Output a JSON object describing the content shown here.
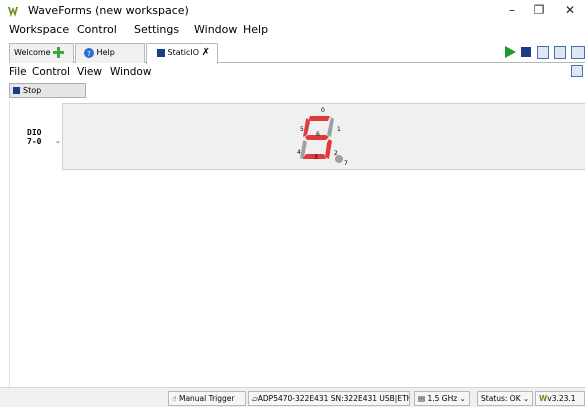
{
  "window": {
    "title": "WaveForms (new workspace)",
    "minimize": "–",
    "restore": "❐",
    "close": "✕"
  },
  "main_menu": [
    "Workspace",
    "Control",
    "Settings",
    "Window",
    "Help"
  ],
  "tabs": [
    {
      "label": "Welcome",
      "icon": "plus-icon"
    },
    {
      "label": "Help",
      "icon": "help-icon"
    },
    {
      "label": "StaticIO",
      "icon": "instrument-icon",
      "active": true
    }
  ],
  "instrument_menu": [
    "File",
    "Control",
    "View",
    "Window"
  ],
  "stop_button": "Stop",
  "dio": {
    "label_line1": "DIO",
    "label_line2": "7-0",
    "segment_labels": [
      "0",
      "1",
      "2",
      "3",
      "4",
      "5",
      "6",
      "7"
    ],
    "lit_segments": [
      0,
      5,
      6,
      2,
      3
    ],
    "on_color": "#e03a3a",
    "off_color": "#a0a0a0"
  },
  "status": {
    "trigger": "Manual Trigger",
    "device": "ADP5470-322E431 SN:322E431 USB|ETH",
    "freq": "1.5 GHz",
    "status": "Status: OK",
    "version": "v3.23.1"
  }
}
